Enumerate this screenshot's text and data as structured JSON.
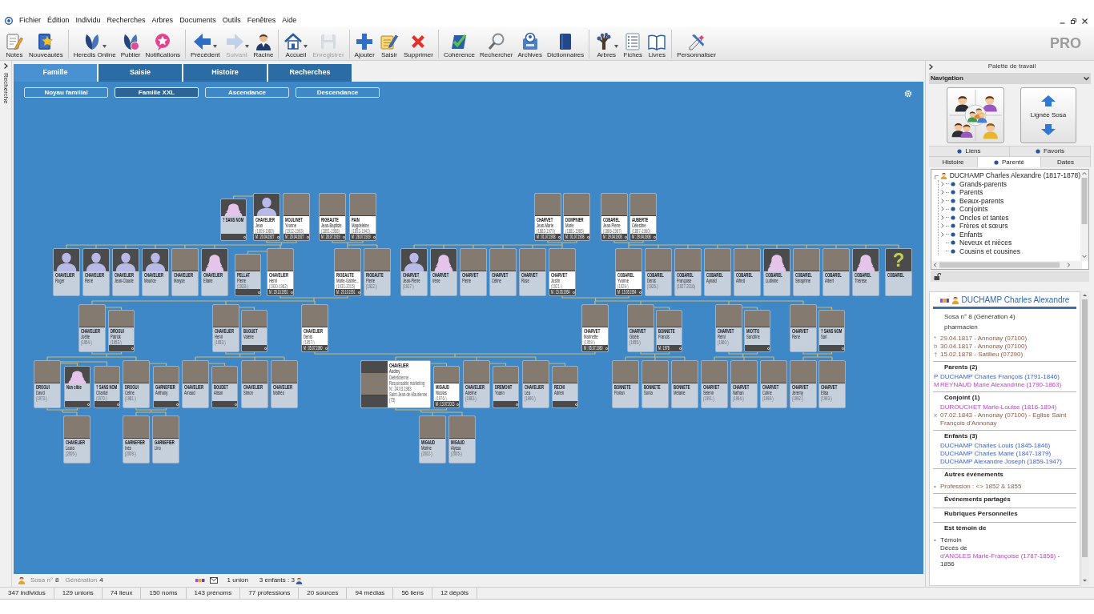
{
  "menu": [
    "Fichier",
    "Édition",
    "Individu",
    "Recherches",
    "Arbres",
    "Documents",
    "Outils",
    "Fenêtres",
    "Aide"
  ],
  "toolbar": {
    "groups": [
      [
        {
          "label": "Notes",
          "disabled": false,
          "dropdown": false
        },
        {
          "label": "Nouveautés",
          "disabled": false,
          "dropdown": false
        }
      ],
      [
        {
          "label": "Heredis Online",
          "disabled": false,
          "dropdown": true
        },
        {
          "label": "Publier",
          "disabled": false,
          "dropdown": false
        },
        {
          "label": "Notifications",
          "disabled": false,
          "dropdown": false
        }
      ],
      [
        {
          "label": "Précédent",
          "disabled": false,
          "dropdown": true
        },
        {
          "label": "Suivant",
          "disabled": true,
          "dropdown": true
        },
        {
          "label": "Racine",
          "disabled": false,
          "dropdown": false
        }
      ],
      [
        {
          "label": "Accueil",
          "disabled": false,
          "dropdown": true
        },
        {
          "label": "Enregistrer",
          "disabled": true,
          "dropdown": false
        }
      ],
      [
        {
          "label": "Ajouter",
          "disabled": false,
          "dropdown": false
        },
        {
          "label": "Saisir",
          "disabled": false,
          "dropdown": false
        },
        {
          "label": "Supprimer",
          "disabled": false,
          "dropdown": false
        }
      ],
      [
        {
          "label": "Cohérence",
          "disabled": false,
          "dropdown": false
        },
        {
          "label": "Rechercher",
          "disabled": false,
          "dropdown": false
        },
        {
          "label": "Archives",
          "disabled": false,
          "dropdown": false
        },
        {
          "label": "Dictionnaires",
          "disabled": false,
          "dropdown": false
        }
      ],
      [
        {
          "label": "Arbres",
          "disabled": false,
          "dropdown": true
        },
        {
          "label": "Fiches",
          "disabled": false,
          "dropdown": false
        },
        {
          "label": "Livres",
          "disabled": false,
          "dropdown": false
        }
      ],
      [
        {
          "label": "Personnaliser",
          "disabled": false,
          "dropdown": false
        }
      ]
    ],
    "edition": "PRO"
  },
  "side_tab": {
    "label": "Recherche"
  },
  "tabs": [
    {
      "label": "Famille",
      "selected": true
    },
    {
      "label": "Saisie",
      "selected": false
    },
    {
      "label": "Histoire",
      "selected": false
    },
    {
      "label": "Recherches",
      "selected": false
    }
  ],
  "view_buttons": [
    {
      "label": "Noyau familial",
      "selected": false
    },
    {
      "label": "Famille XXL",
      "selected": true
    },
    {
      "label": "Ascendance",
      "selected": false
    },
    {
      "label": "Descendance",
      "selected": false
    }
  ],
  "tree": {
    "generations": [
      [
        {
          "kind": "spouse",
          "surname": "? SANS NOM",
          "portrait": {
            "kind": "woman"
          },
          "direct": false
        },
        {
          "kind": "person",
          "surname": "CHAVELIER",
          "given": "Jean",
          "dates": "(1909-1980)",
          "marriage": "M : 20.04.1927",
          "portrait": {
            "kind": "man"
          },
          "direct": true
        },
        {
          "kind": "person",
          "surname": "MOULINET",
          "given": "Yvonne",
          "dates": "(1912-1993)",
          "marriage": "M : 20.04.1927",
          "portrait": {
            "kind": "photo"
          },
          "direct": true
        },
        {
          "kind": "person",
          "surname": "RIGEAUTE",
          "given": "Jean-Baptiste",
          "dates": "(1891-1968)",
          "marriage": "M : 28.07.1919",
          "portrait": {
            "kind": "photo"
          },
          "direct": true
        },
        {
          "kind": "person",
          "surname": "PAIN",
          "given": "Magdeleine",
          "dates": "(1893-1941)",
          "marriage": "M : 28.07.1919",
          "portrait": {
            "kind": "photo"
          },
          "direct": true
        },
        {
          "kind": "person",
          "surname": "CHARVET",
          "given": "Jean-Marie",
          "dates": "(1882-1970)",
          "marriage": "M : 01.07.1908",
          "portrait": {
            "kind": "photo"
          },
          "direct": true
        },
        {
          "kind": "person",
          "surname": "DOMPNIER",
          "given": "Marie",
          "dates": "(1881-1965)",
          "marriage": "M : 01.07.1908",
          "portrait": {
            "kind": "photo"
          },
          "direct": true
        },
        {
          "kind": "person",
          "surname": "COBAREL",
          "given": "Jean-Pierre",
          "dates": "(1886-1967)",
          "marriage": "M : 29.04.1908",
          "portrait": {
            "kind": "photo"
          },
          "direct": true
        },
        {
          "kind": "person",
          "surname": "AUBERTE",
          "given": "Célestine",
          "dates": "(1887-1960)",
          "marriage": "M : 29.04.1908",
          "portrait": {
            "kind": "photo"
          },
          "direct": true
        }
      ],
      [
        {
          "kind": "person",
          "surname": "CHAVELIER",
          "given": "Roger",
          "portrait": {
            "kind": "man"
          },
          "direct": false
        },
        {
          "kind": "person",
          "surname": "CHAVELIER",
          "given": "René",
          "portrait": {
            "kind": "man"
          },
          "direct": false
        },
        {
          "kind": "person",
          "surname": "CHAVELIER",
          "given": "Jean-Claude",
          "portrait": {
            "kind": "man"
          },
          "direct": false
        },
        {
          "kind": "person",
          "surname": "CHAVELIER",
          "given": "Maurice",
          "portrait": {
            "kind": "man"
          },
          "direct": false
        },
        {
          "kind": "person",
          "surname": "CHAVELIER",
          "given": "Maryse",
          "portrait": {
            "kind": "photo"
          },
          "direct": false
        },
        {
          "kind": "person",
          "surname": "CHAVELIER",
          "given": "Eliane",
          "portrait": {
            "kind": "woman"
          },
          "direct": false
        },
        {
          "kind": "spouse",
          "surname": "PELLAT",
          "given": "Pierre",
          "dates": "(1928-)",
          "portrait": {
            "kind": "photo"
          },
          "direct": false
        },
        {
          "kind": "person",
          "surname": "CHAVELIER",
          "given": "Henri",
          "dates": "(1930-1962)",
          "marriage": "M : 20.10.1951",
          "portrait": {
            "kind": "photo"
          },
          "direct": true
        },
        {
          "kind": "person",
          "surname": "RIGEAUTE",
          "given": "Marie-Gabrie…",
          "dates": "(1931-2015)",
          "marriage": "M : 20.10.1951",
          "portrait": {
            "kind": "photo"
          },
          "direct": true
        },
        {
          "kind": "person",
          "surname": "RIGEAUTE",
          "given": "Pierre",
          "dates": "(1922-)",
          "portrait": {
            "kind": "photo"
          },
          "direct": false
        },
        {
          "kind": "person",
          "surname": "CHARVET",
          "given": "Jean-Pierre",
          "dates": "(1917-)",
          "portrait": {
            "kind": "man"
          },
          "direct": false
        },
        {
          "kind": "person",
          "surname": "CHARVET",
          "given": "Irène",
          "portrait": {
            "kind": "woman"
          },
          "direct": false
        },
        {
          "kind": "person",
          "surname": "CHARVET",
          "given": "Pierre",
          "portrait": {
            "kind": "photo"
          },
          "direct": false
        },
        {
          "kind": "person",
          "surname": "CHARVET",
          "given": "Céline",
          "portrait": {
            "kind": "photo"
          },
          "direct": false
        },
        {
          "kind": "person",
          "surname": "CHARVET",
          "given": "Rose",
          "portrait": {
            "kind": "photo"
          },
          "direct": false
        },
        {
          "kind": "person",
          "surname": "CHARVET",
          "given": "Justin",
          "dates": "(1921-)",
          "marriage": "M : 15.05.1954",
          "portrait": {
            "kind": "photo"
          },
          "direct": true
        },
        {
          "kind": "person",
          "surname": "COBAREL",
          "given": "Yvonne",
          "dates": "(1929-)",
          "marriage": "M : 15.05.1954",
          "portrait": {
            "kind": "photo"
          },
          "direct": true
        },
        {
          "kind": "person",
          "surname": "COBAREL",
          "given": "Denis",
          "dates": "(1926-)",
          "portrait": {
            "kind": "photo"
          },
          "direct": false
        },
        {
          "kind": "person",
          "surname": "COBAREL",
          "given": "Françoise",
          "dates": "(1927-2016)",
          "portrait": {
            "kind": "photo"
          },
          "direct": false
        },
        {
          "kind": "person",
          "surname": "COBAREL",
          "given": "Aynald",
          "portrait": {
            "kind": "photo"
          },
          "direct": false
        },
        {
          "kind": "person",
          "surname": "COBAREL",
          "given": "Alfred",
          "portrait": {
            "kind": "photo"
          },
          "direct": false
        },
        {
          "kind": "person",
          "surname": "COBAREL",
          "given": "Ludivine",
          "portrait": {
            "kind": "woman"
          },
          "direct": false
        },
        {
          "kind": "person",
          "surname": "COBAREL",
          "given": "Séraphine",
          "portrait": {
            "kind": "photo"
          },
          "direct": false
        },
        {
          "kind": "person",
          "surname": "COBAREL",
          "given": "Albert",
          "portrait": {
            "kind": "photo"
          },
          "direct": false
        },
        {
          "kind": "person",
          "surname": "COBAREL",
          "given": "Thérèse",
          "portrait": {
            "kind": "woman"
          },
          "direct": false
        },
        {
          "kind": "person",
          "surname": "COBAREL",
          "portrait": {
            "kind": "unknown",
            "mark": "?"
          },
          "direct": false
        }
      ],
      [
        {
          "kind": "person",
          "surname": "CHAVELIER",
          "given": "Joëlle",
          "dates": "(1954-)",
          "portrait": {
            "kind": "photo"
          },
          "direct": false
        },
        {
          "kind": "spouse",
          "surname": "DROGUI",
          "given": "Patrick",
          "dates": "(1953-)",
          "portrait": {
            "kind": "photo"
          },
          "direct": false
        },
        {
          "kind": "person",
          "surname": "CHAVELIER",
          "given": "Henri",
          "dates": "(1953-)",
          "portrait": {
            "kind": "photo"
          },
          "direct": false
        },
        {
          "kind": "spouse",
          "surname": "BUGUET",
          "given": "Valérie",
          "portrait": {
            "kind": "photo"
          },
          "direct": false
        },
        {
          "kind": "person",
          "surname": "CHAVELIER",
          "given": "Denis",
          "dates": "(1957-)",
          "marriage": "M : 05.07.1980",
          "portrait": {
            "kind": "photo"
          },
          "direct": true
        },
        {
          "kind": "person",
          "surname": "CHARVET",
          "given": "Marinette",
          "dates": "(1959-)",
          "marriage": "M : 05.07.1980",
          "portrait": {
            "kind": "photo"
          },
          "direct": true
        },
        {
          "kind": "person",
          "surname": "CHARVET",
          "given": "Gisèle",
          "dates": "(1955-)",
          "portrait": {
            "kind": "photo"
          },
          "direct": false
        },
        {
          "kind": "spouse",
          "surname": "BONNETE",
          "given": "Francis",
          "marriage": "M : 1978",
          "portrait": {
            "kind": "photo"
          },
          "direct": false
        },
        {
          "kind": "person",
          "surname": "CHARVET",
          "given": "Rémi",
          "dates": "(1960-)",
          "portrait": {
            "kind": "photo"
          },
          "direct": false
        },
        {
          "kind": "spouse",
          "surname": "MIOTTO",
          "given": "Sandrine",
          "portrait": {
            "kind": "photo"
          },
          "direct": false
        },
        {
          "kind": "person",
          "surname": "CHARVET",
          "given": "René",
          "portrait": {
            "kind": "photo"
          },
          "direct": false
        },
        {
          "kind": "spouse",
          "surname": "? SANS NOM",
          "given": "Sari",
          "portrait": {
            "kind": "photo"
          },
          "direct": false
        }
      ],
      [
        {
          "kind": "person",
          "surname": "DROGUI",
          "given": "David",
          "dates": "(1973-)",
          "portrait": {
            "kind": "photo"
          },
          "direct": false
        },
        {
          "kind": "spouse",
          "surname": "Non citée",
          "portrait": {
            "kind": "woman"
          },
          "direct": false
        },
        {
          "kind": "spouse",
          "surname": "? SANS NOM",
          "given": "Chantal",
          "dates": "(1970-)",
          "portrait": {
            "kind": "photo"
          },
          "direct": false
        },
        {
          "kind": "person",
          "surname": "DROGUI",
          "given": "Celine",
          "dates": "(1981-)",
          "portrait": {
            "kind": "photo"
          },
          "direct": false
        },
        {
          "kind": "spouse",
          "surname": "GARNEFIER",
          "given": "Anthony",
          "portrait": {
            "kind": "photo"
          },
          "direct": false
        },
        {
          "kind": "person",
          "surname": "CHAVELIER",
          "given": "Arnaud",
          "portrait": {
            "kind": "photo"
          },
          "direct": false
        },
        {
          "kind": "spouse",
          "surname": "BOUDET",
          "given": "Alison",
          "portrait": {
            "kind": "photo"
          },
          "direct": false
        },
        {
          "kind": "person",
          "surname": "CHAVELIER",
          "given": "Simon",
          "portrait": {
            "kind": "photo"
          },
          "direct": false
        },
        {
          "kind": "person",
          "surname": "CHAVELIER",
          "given": "Mathéo",
          "portrait": {
            "kind": "photo"
          },
          "direct": false
        },
        {
          "kind": "detailed",
          "surname": "CHAVELIER",
          "given": "Audrey",
          "details": [
            "Diététicienne - Responsable marketing",
            "N : 24.03.1983",
            "Saint-Jean-de-Maurienne (73)"
          ],
          "portrait": {
            "kind": "photo"
          },
          "direct": true
        },
        {
          "kind": "spouse",
          "surname": "MIGAUD",
          "given": "Nicolas",
          "dates": "(1976-)",
          "marriage": "M : 13.07.2013",
          "portrait": {
            "kind": "photo"
          },
          "direct": true
        },
        {
          "kind": "person",
          "surname": "CHAVELIER",
          "given": "Adeline",
          "dates": "(1983-)",
          "portrait": {
            "kind": "photo"
          },
          "direct": false
        },
        {
          "kind": "spouse",
          "surname": "DREMONT",
          "given": "Yoann",
          "portrait": {
            "kind": "photo"
          },
          "direct": false
        },
        {
          "kind": "person",
          "surname": "CHAVELIER",
          "given": "Léa",
          "dates": "(1990-)",
          "portrait": {
            "kind": "photo"
          },
          "direct": false
        },
        {
          "kind": "spouse",
          "surname": "RECHI",
          "given": "Adrien",
          "portrait": {
            "kind": "photo"
          },
          "direct": false
        },
        {
          "kind": "person",
          "surname": "BONNETE",
          "given": "Florian",
          "portrait": {
            "kind": "photo"
          },
          "direct": false
        },
        {
          "kind": "person",
          "surname": "BONNETE",
          "given": "Sonia",
          "portrait": {
            "kind": "photo"
          },
          "direct": false
        },
        {
          "kind": "person",
          "surname": "BONNETE",
          "given": "Mélanie",
          "portrait": {
            "kind": "photo"
          },
          "direct": false
        },
        {
          "kind": "person",
          "surname": "CHARVET",
          "given": "Selenn",
          "dates": "(1991-)",
          "portrait": {
            "kind": "photo"
          },
          "direct": false
        },
        {
          "kind": "person",
          "surname": "CHARVET",
          "given": "Nathan",
          "dates": "(1994-)",
          "portrait": {
            "kind": "photo"
          },
          "direct": false
        },
        {
          "kind": "person",
          "surname": "CHARVET",
          "given": "Coline",
          "dates": "(1998-)",
          "portrait": {
            "kind": "photo"
          },
          "direct": false
        },
        {
          "kind": "person",
          "surname": "CHARVET",
          "given": "Jeremy",
          "dates": "(1992-)",
          "portrait": {
            "kind": "photo"
          },
          "direct": false
        },
        {
          "kind": "person",
          "surname": "CHARVET",
          "given": "Elisa",
          "dates": "(1993-)",
          "portrait": {
            "kind": "photo"
          },
          "direct": false
        }
      ],
      [
        {
          "kind": "person",
          "surname": "CHAVELIER",
          "given": "Laura",
          "dates": "(2005-)",
          "portrait": {
            "kind": "photo"
          },
          "direct": false
        },
        {
          "kind": "person",
          "surname": "GARNEFIER",
          "given": "Inès",
          "dates": "(2009-)",
          "portrait": {
            "kind": "photo"
          },
          "direct": false
        },
        {
          "kind": "person",
          "surname": "GARNEFIER",
          "given": "Lino",
          "portrait": {
            "kind": "photo"
          },
          "direct": false
        },
        {
          "kind": "person",
          "surname": "MIGAUD",
          "given": "Marine",
          "dates": "(2002-)",
          "portrait": {
            "kind": "photo"
          },
          "direct": false
        },
        {
          "kind": "person",
          "surname": "MIGAUD",
          "given": "Alyssa",
          "dates": "(2005-)",
          "portrait": {
            "kind": "photo"
          },
          "direct": false
        }
      ]
    ]
  },
  "status": {
    "sosa_label": "Sosa n°",
    "sosa": "8",
    "generation_label": "Génération",
    "generation": "4",
    "unions": "1 union",
    "children": "3 enfants : 3"
  },
  "counts": [
    "347 individus",
    "129 unions",
    "74 lieux",
    "150 noms",
    "143 prénoms",
    "77 professions",
    "20 sources",
    "94 médias",
    "56 liens",
    "12 dépôts"
  ],
  "palette": {
    "title": "Palette de travail",
    "navigation": {
      "title": "Navigation",
      "sosa_button": "Lignée Sosa"
    },
    "tabs_top": [
      {
        "label": "Liens",
        "selected": false,
        "dot": true
      },
      {
        "label": "Favoris",
        "selected": false,
        "dot": true
      }
    ],
    "tabs": [
      {
        "label": "Histoire",
        "selected": false,
        "dot": false
      },
      {
        "label": "Parenté",
        "selected": true,
        "dot": true
      },
      {
        "label": "Dates",
        "selected": false,
        "dot": false
      }
    ],
    "relations": {
      "label": "DUCHAMP Charles Alexandre (1817-1878)",
      "children": [
        {
          "label": "Grands-parents",
          "expandable": true
        },
        {
          "label": "Parents",
          "expandable": true
        },
        {
          "label": "Beaux-parents",
          "expandable": true
        },
        {
          "label": "Conjoints",
          "expandable": true
        },
        {
          "label": "Oncles et tantes",
          "expandable": true
        },
        {
          "label": "Frères et sœurs",
          "expandable": true
        },
        {
          "label": "Enfants",
          "expandable": true
        },
        {
          "label": "Neveux et nièces",
          "expandable": false
        },
        {
          "label": "Cousins et cousines",
          "expandable": false
        }
      ]
    }
  },
  "person": {
    "name": "DUCHAMP Charles Alexandre",
    "sosa": "Sosa n° 8 (Génération 4)",
    "occupation": "pharmacien",
    "events": [
      {
        "marker": "*",
        "text": "29.04.1817 - Annonay (07100)"
      },
      {
        "marker": "b",
        "text": "30.04.1817 - Annonay (07100)"
      },
      {
        "marker": "†",
        "text": "15.02.1878 - Satilieu (07290)"
      }
    ],
    "sections": [
      {
        "title": "Parents (2)",
        "entries": [
          {
            "kind": "male",
            "marker": "P",
            "text": "DUCHAMP Charles François (1791-1846)"
          },
          {
            "kind": "female",
            "marker": "M",
            "text": "REYNAUD Marie Alexandrine (1790-1863)"
          }
        ]
      },
      {
        "title": "Conjoint (1)",
        "entries": [
          {
            "kind": "female",
            "text": "DUROUCHET Marie-Louise (1816-1894)"
          },
          {
            "kind": "event",
            "marker": "x",
            "text": "07.02.1843 - Annonay (07100) - Eglise Saint François d'Annonay"
          }
        ]
      },
      {
        "title": "Enfants (3)",
        "entries": [
          {
            "kind": "male",
            "text": "DUCHAMP Charles Louis (1845-1846)"
          },
          {
            "kind": "male",
            "text": "DUCHAMP Charles Marie (1847-1879)"
          },
          {
            "kind": "male",
            "text": "DUCHAMP Alexandre Joseph (1859-1947)"
          }
        ]
      },
      {
        "title": "Autres événements",
        "entries": [
          {
            "kind": "event",
            "marker": "•",
            "text": "Profession : <> 1852 & 1855"
          }
        ]
      },
      {
        "title": "Événements partagés"
      },
      {
        "title": "Rubriques Personnelles"
      },
      {
        "title": "Est témoin de",
        "entries": [
          {
            "kind": "witness",
            "marker": "•",
            "role": "Témoin",
            "prefix": "Décès de",
            "link": "d'ANGLES Marie-Françoise (1787-1856)",
            "suffix": "- 1856"
          }
        ]
      }
    ]
  }
}
